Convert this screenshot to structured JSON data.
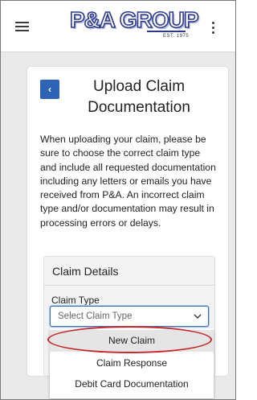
{
  "header": {
    "logo_name": "P&A GROUP",
    "logo_est": "EST. 1975",
    "menu_icon": "hamburger-menu-icon",
    "more_icon": "kebab-menu-icon"
  },
  "page": {
    "back_label": "‹",
    "title": "Upload Claim Documentation",
    "description": "When uploading your claim, please be sure to choose the correct claim type and include all requested documentation including any letters or emails you have received from P&A. An incorrect claim type and/or documentation may result in processing errors or delays."
  },
  "claim_details": {
    "heading": "Claim Details",
    "claim_type_label": "Claim Type",
    "claim_type_placeholder": "Select Claim Type",
    "options": [
      "New Claim",
      "Claim Response",
      "Debit Card Documentation"
    ],
    "highlighted_option": "New Claim"
  },
  "colors": {
    "accent": "#2f63b5",
    "highlight_ring": "#c6282b"
  }
}
